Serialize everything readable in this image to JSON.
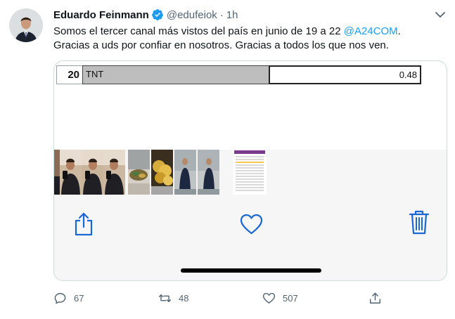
{
  "author": {
    "name": "Eduardo Feinmann",
    "handle": "@edufeiok",
    "separator": "·",
    "time": "1h",
    "verified": true
  },
  "tweet": {
    "line1_text": "Somos el tercer canal más vistos del país en junio de 19 a 22 ",
    "line1_mention": "@A24COM",
    "line1_end": ".",
    "line2_text": "Gracias a uds por confiar en nosotros. Gracias a todos los que nos ven."
  },
  "media": {
    "table_row": {
      "rank": "20",
      "channel": "TNT",
      "value": "0.48"
    },
    "thumbnails": [
      "selfie-photo",
      "selfie-photo",
      "selfie-photo",
      "food-photo",
      "gold-coins-photo",
      "man-in-suit-photo",
      "man-in-suit-photo",
      "ratings-table-photo"
    ],
    "actions": [
      "share-icon",
      "heart-icon",
      "trash-icon"
    ]
  },
  "footer": {
    "replies": "67",
    "retweets": "48",
    "likes": "507"
  },
  "colors": {
    "accent": "#1d9bf0",
    "ios_blue": "#1a67d2",
    "secondary_text": "#536471",
    "border": "#cfd9de"
  }
}
